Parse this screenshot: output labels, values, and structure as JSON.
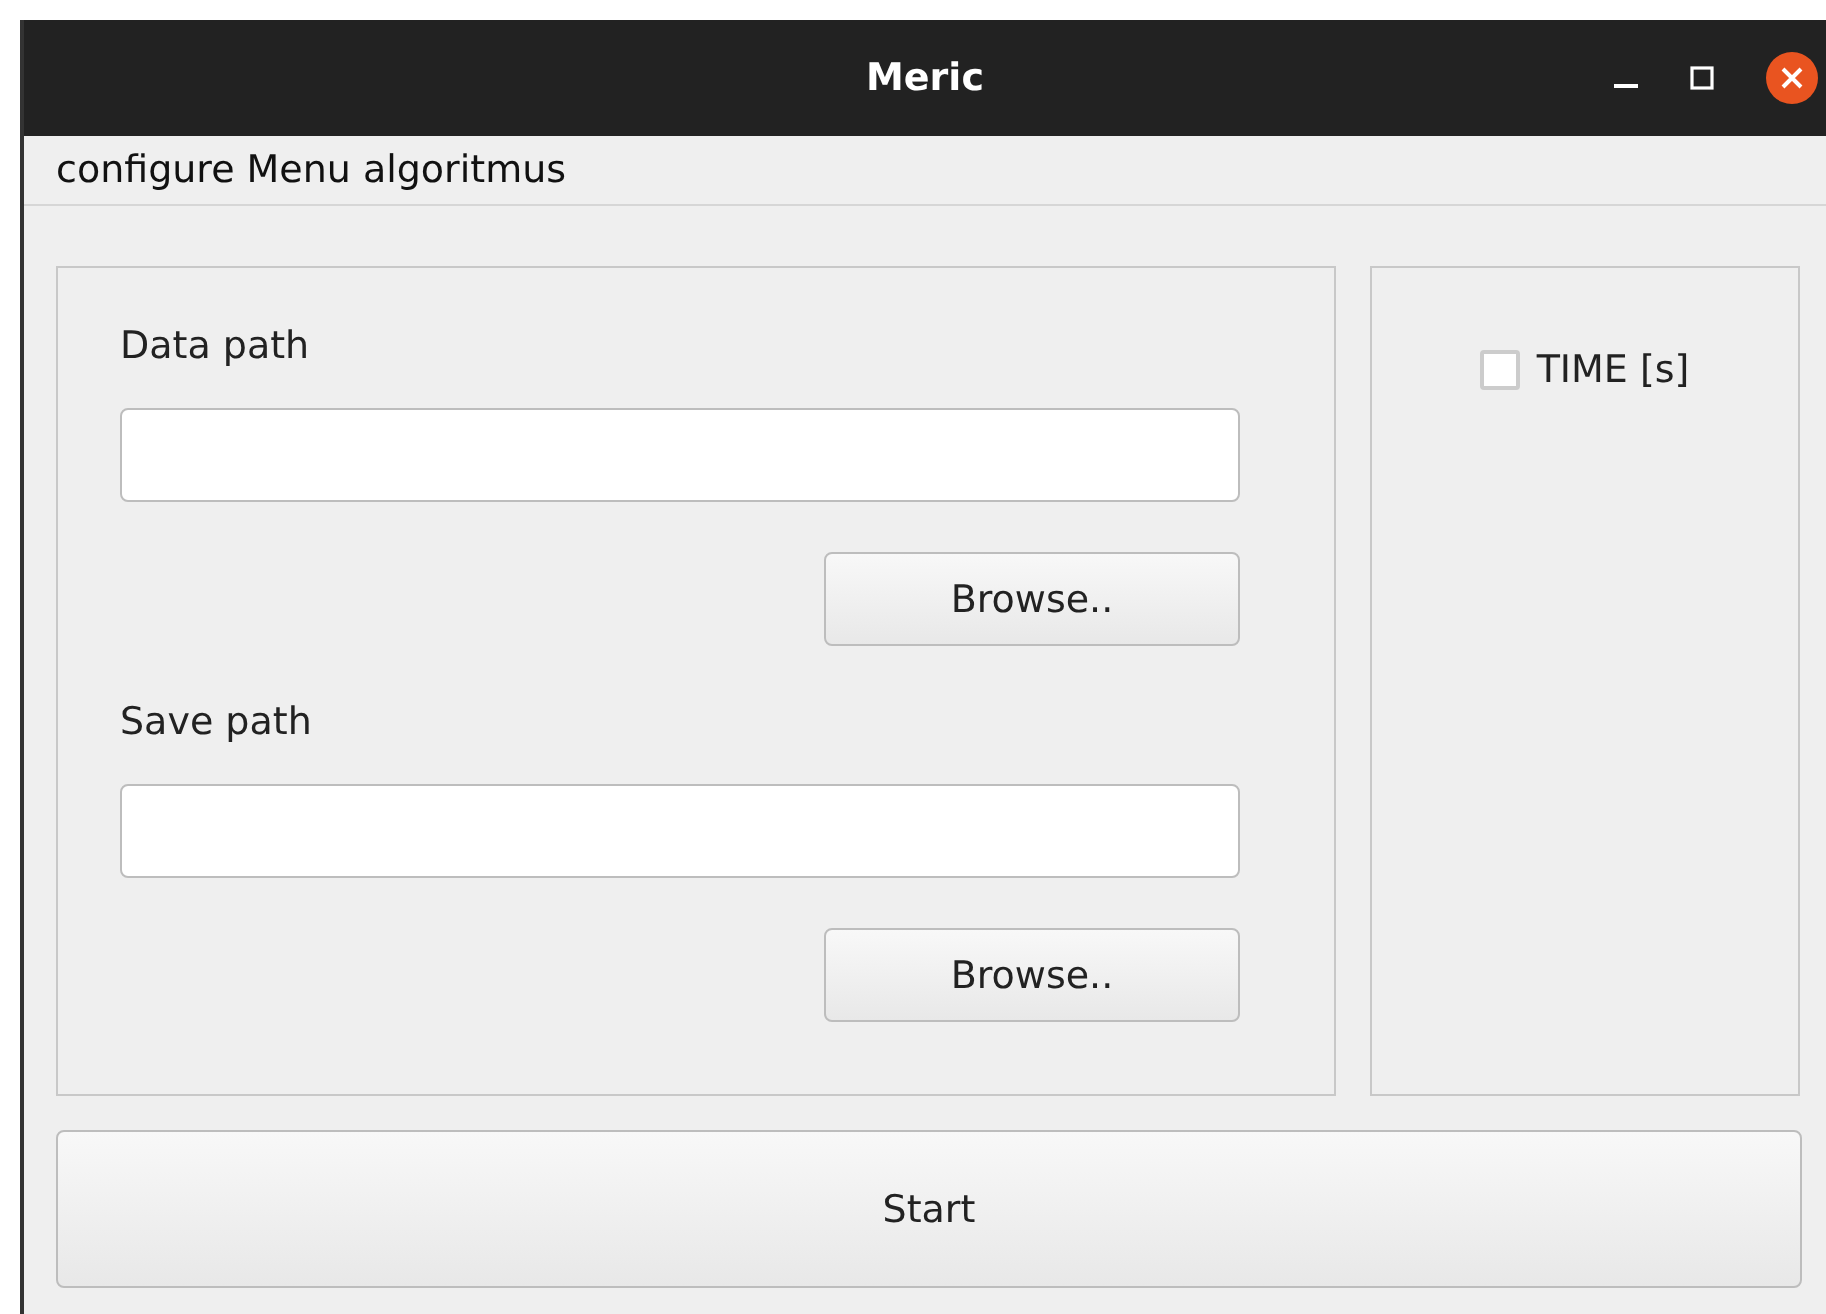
{
  "window": {
    "title": "Meric"
  },
  "menu": [
    "configure",
    "Menu",
    "algoritmus"
  ],
  "paths": [
    {
      "label": "Data path",
      "button": "Browse.."
    },
    {
      "label": "Save path",
      "button": "Browse.."
    }
  ],
  "options": [
    {
      "label": "TIME [s]",
      "checked": false
    }
  ],
  "start_button": "Start"
}
